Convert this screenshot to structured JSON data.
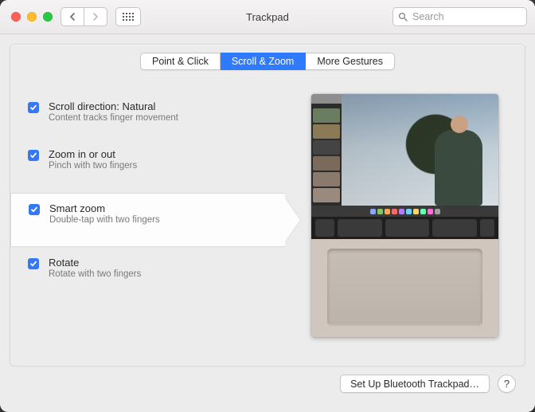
{
  "window": {
    "title": "Trackpad"
  },
  "toolbar": {
    "search_placeholder": "Search"
  },
  "tabs": [
    {
      "label": "Point & Click",
      "active": false
    },
    {
      "label": "Scroll & Zoom",
      "active": true
    },
    {
      "label": "More Gestures",
      "active": false
    }
  ],
  "options": [
    {
      "id": "scroll-direction",
      "title": "Scroll direction: Natural",
      "sub": "Content tracks finger movement",
      "checked": true,
      "highlighted": false
    },
    {
      "id": "zoom",
      "title": "Zoom in or out",
      "sub": "Pinch with two fingers",
      "checked": true,
      "highlighted": false
    },
    {
      "id": "smart-zoom",
      "title": "Smart zoom",
      "sub": "Double-tap with two fingers",
      "checked": true,
      "highlighted": true
    },
    {
      "id": "rotate",
      "title": "Rotate",
      "sub": "Rotate with two fingers",
      "checked": true,
      "highlighted": false
    }
  ],
  "footer": {
    "setup_button": "Set Up Bluetooth Trackpad…",
    "help": "?"
  }
}
